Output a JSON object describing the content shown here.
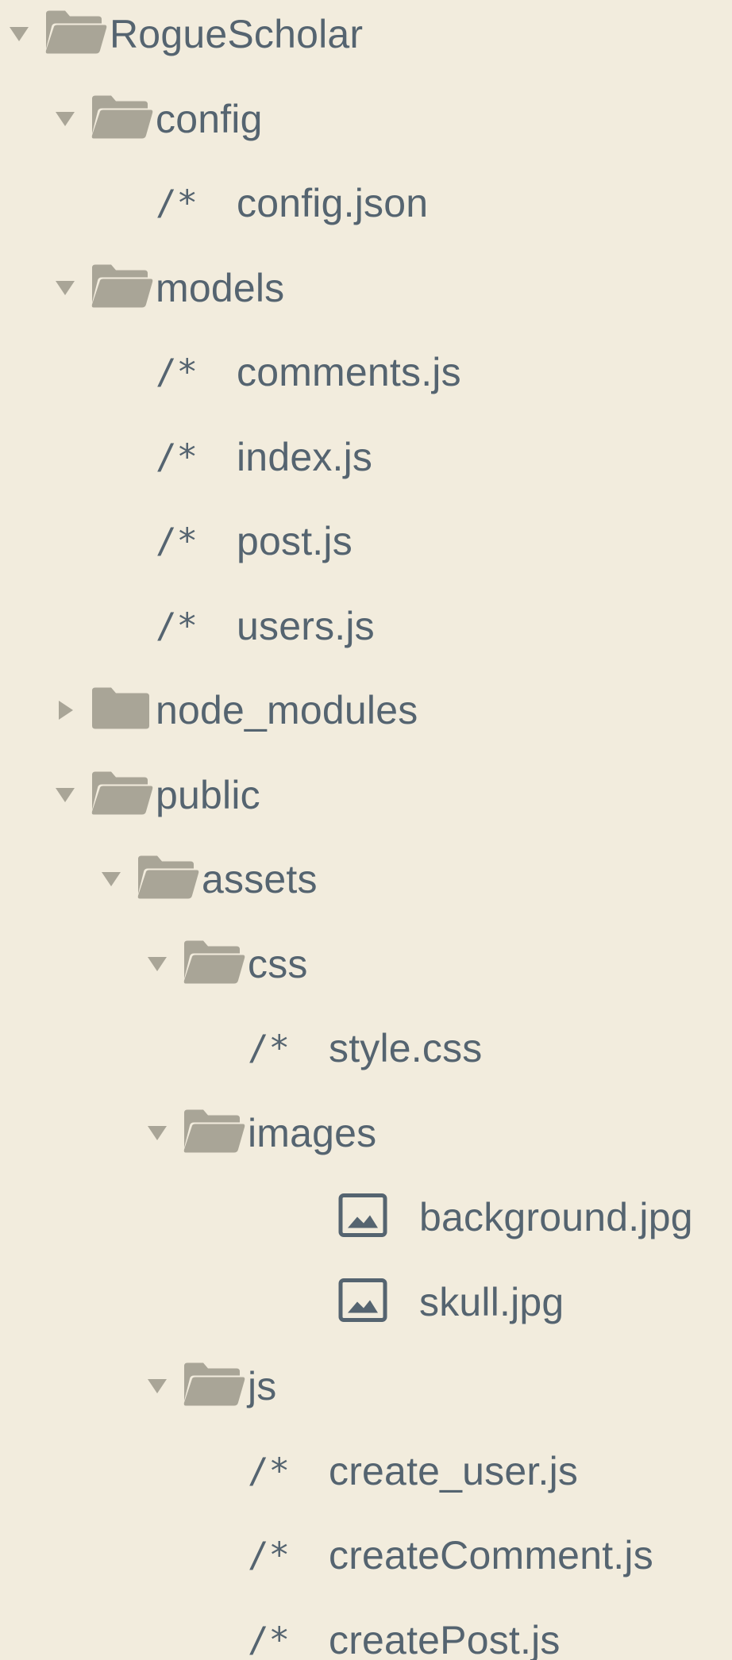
{
  "tree": [
    {
      "type": "folder",
      "expanded": true,
      "depth": 0,
      "name": "RogueScholar",
      "icon": "folder-open-icon"
    },
    {
      "type": "folder",
      "expanded": true,
      "depth": 1,
      "name": "config",
      "icon": "folder-open-icon"
    },
    {
      "type": "file",
      "depth": 2,
      "name": "config.json",
      "glyph": "/*",
      "icon": "code-file-icon"
    },
    {
      "type": "folder",
      "expanded": true,
      "depth": 1,
      "name": "models",
      "icon": "folder-open-icon"
    },
    {
      "type": "file",
      "depth": 2,
      "name": "comments.js",
      "glyph": "/*",
      "icon": "code-file-icon"
    },
    {
      "type": "file",
      "depth": 2,
      "name": "index.js",
      "glyph": "/*",
      "icon": "code-file-icon"
    },
    {
      "type": "file",
      "depth": 2,
      "name": "post.js",
      "glyph": "/*",
      "icon": "code-file-icon"
    },
    {
      "type": "file",
      "depth": 2,
      "name": "users.js",
      "glyph": "/*",
      "icon": "code-file-icon"
    },
    {
      "type": "folder",
      "expanded": false,
      "depth": 1,
      "name": "node_modules",
      "icon": "folder-closed-icon"
    },
    {
      "type": "folder",
      "expanded": true,
      "depth": 1,
      "name": "public",
      "icon": "folder-open-icon"
    },
    {
      "type": "folder",
      "expanded": true,
      "depth": 2,
      "name": "assets",
      "icon": "folder-open-icon"
    },
    {
      "type": "folder",
      "expanded": true,
      "depth": 3,
      "name": "css",
      "icon": "folder-open-icon"
    },
    {
      "type": "file",
      "depth": 4,
      "name": "style.css",
      "glyph": "/*",
      "icon": "code-file-icon"
    },
    {
      "type": "folder",
      "expanded": true,
      "depth": 3,
      "name": "images",
      "icon": "folder-open-icon"
    },
    {
      "type": "image",
      "depth": 4,
      "name": "background.jpg",
      "icon": "image-file-icon"
    },
    {
      "type": "image",
      "depth": 4,
      "name": "skull.jpg",
      "icon": "image-file-icon"
    },
    {
      "type": "folder",
      "expanded": true,
      "depth": 3,
      "name": "js",
      "icon": "folder-open-icon"
    },
    {
      "type": "file",
      "depth": 4,
      "name": "create_user.js",
      "glyph": "/*",
      "icon": "code-file-icon"
    },
    {
      "type": "file",
      "depth": 4,
      "name": "createComment.js",
      "glyph": "/*",
      "icon": "code-file-icon"
    },
    {
      "type": "file",
      "depth": 4,
      "name": "createPost.js",
      "glyph": "/*",
      "icon": "code-file-icon"
    }
  ],
  "colors": {
    "background": "#f2ecdd",
    "text": "#556470",
    "folder": "#a9a597",
    "arrow": "#a9a597"
  }
}
